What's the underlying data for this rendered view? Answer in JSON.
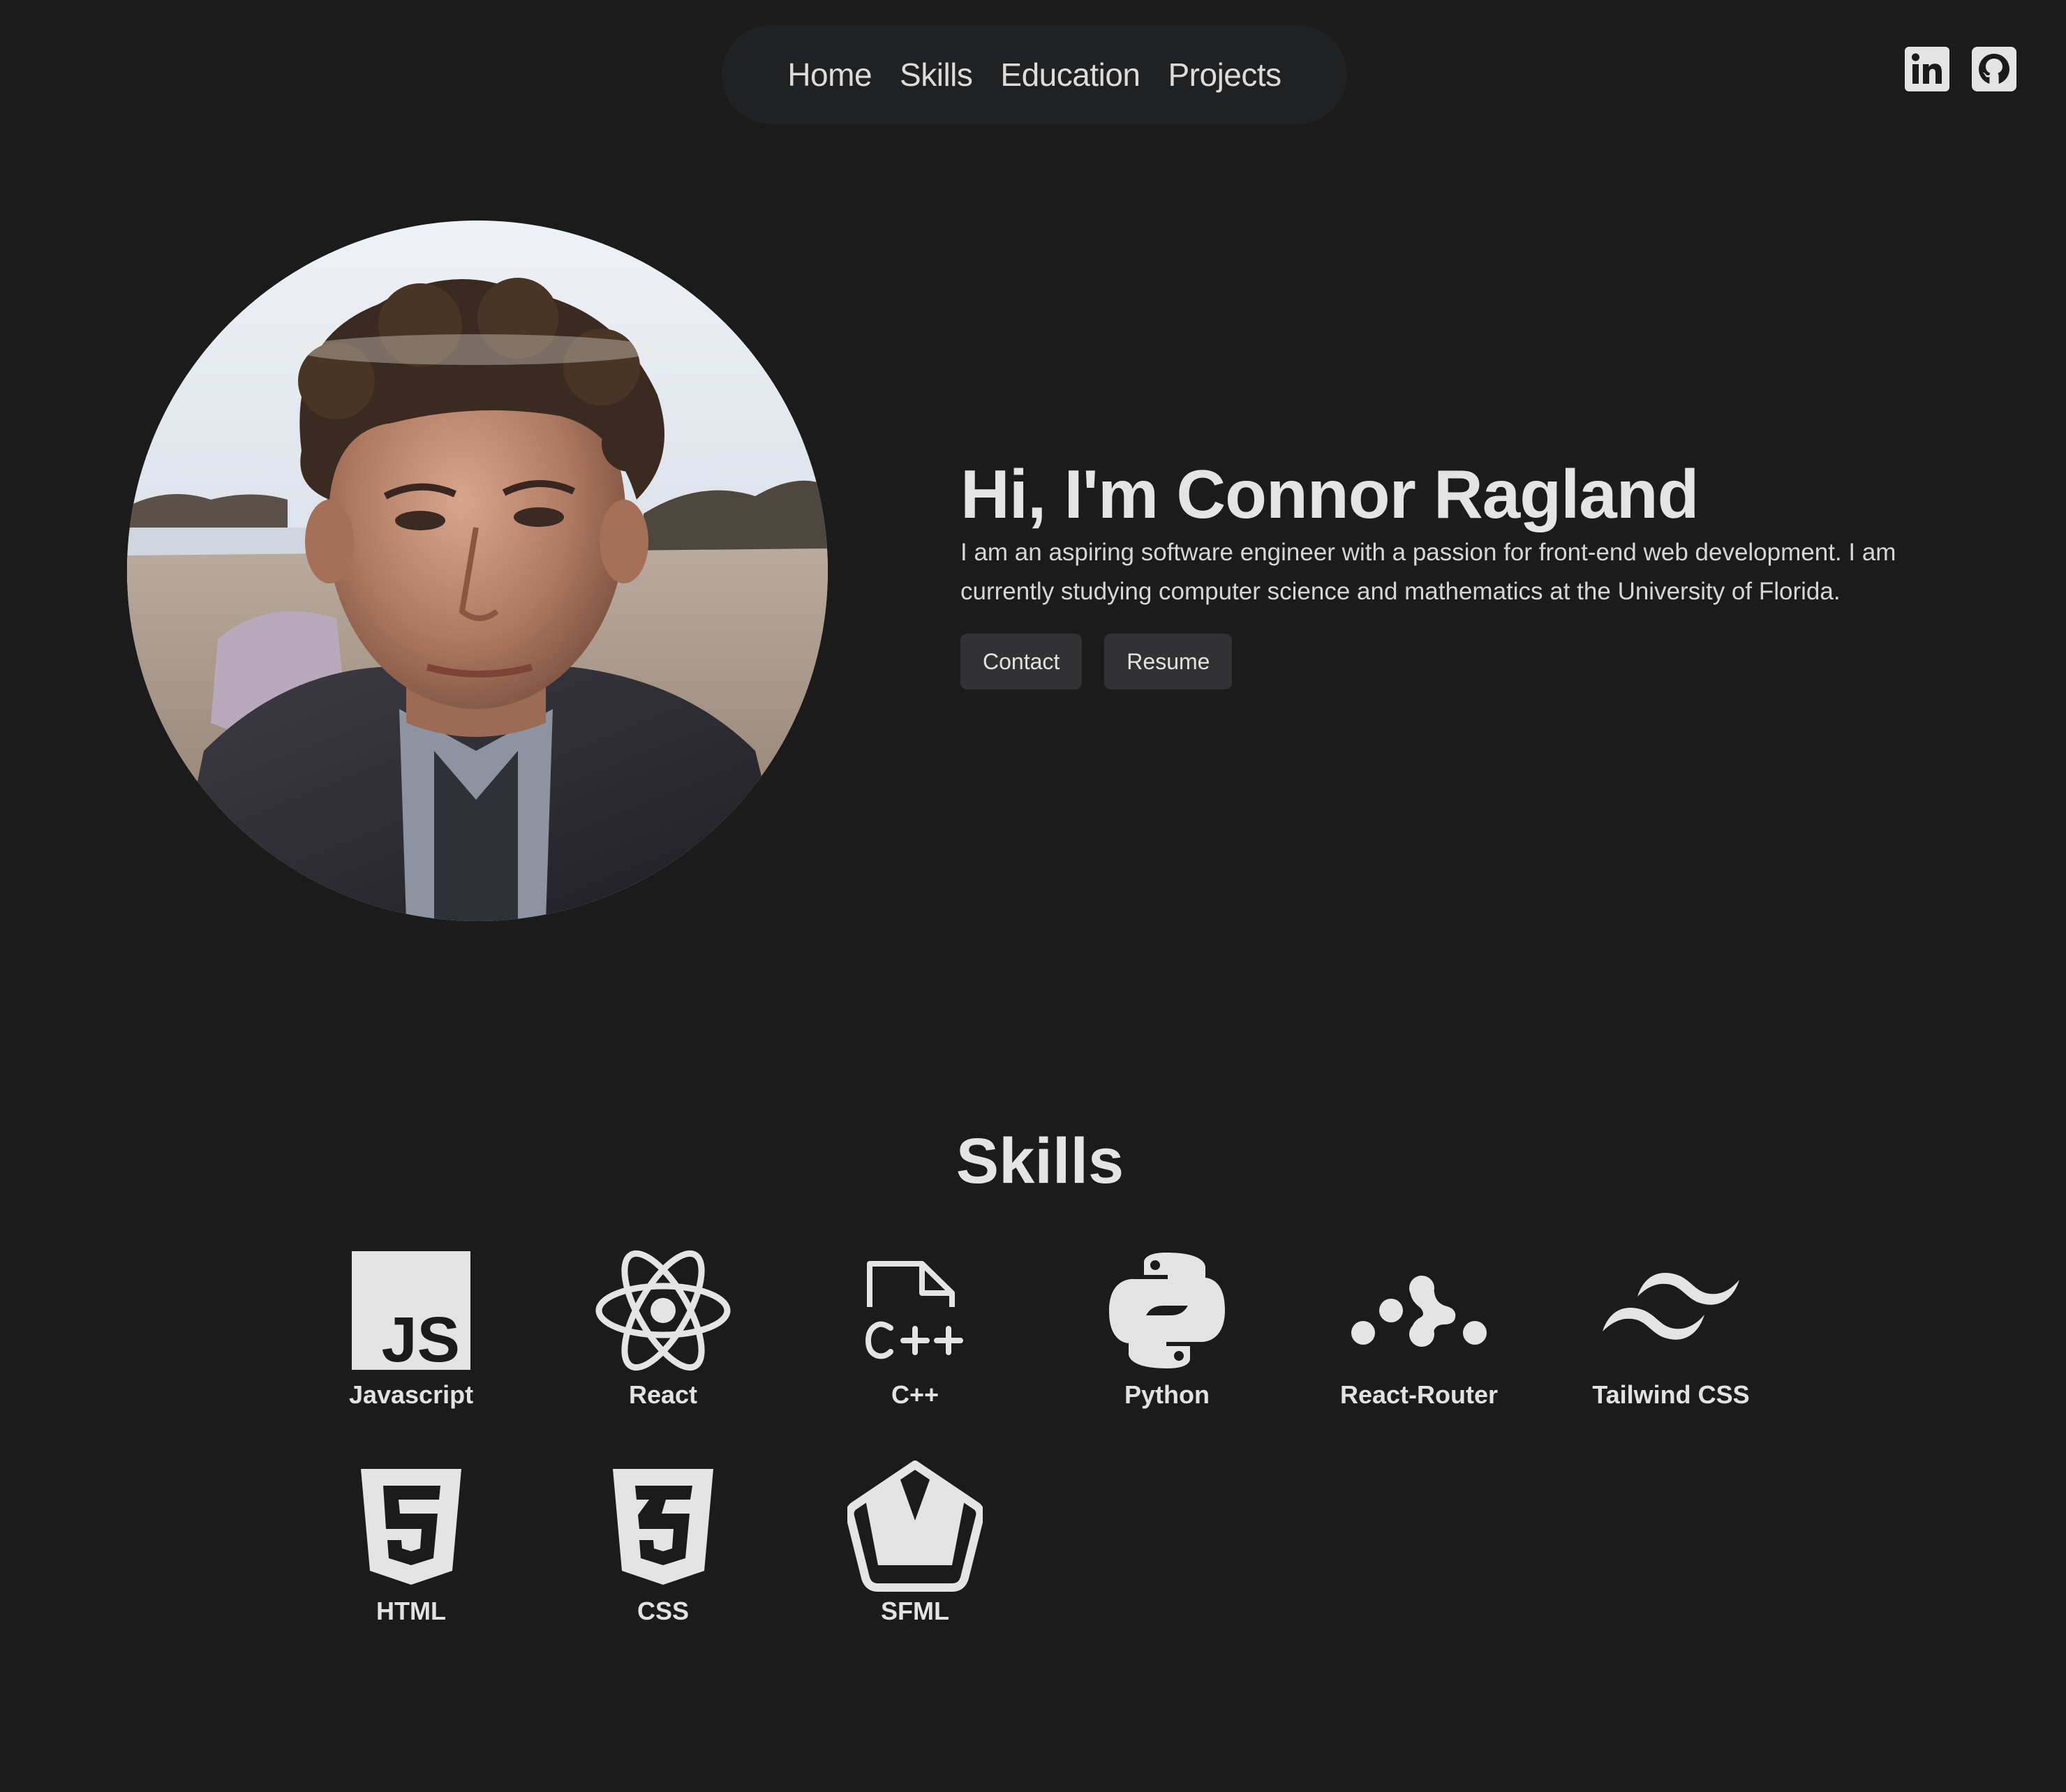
{
  "nav": {
    "items": [
      "Home",
      "Skills",
      "Education",
      "Projects"
    ]
  },
  "socials": {
    "icons": [
      "linkedin-icon",
      "github-icon"
    ]
  },
  "hero": {
    "title": "Hi, I'm Connor Ragland",
    "description": "I am an aspiring software engineer with a passion for front-end web development. I am currently studying computer science and mathematics at the University of Florida.",
    "contact_label": "Contact",
    "resume_label": "Resume"
  },
  "skills": {
    "title": "Skills",
    "items": [
      {
        "label": "Javascript",
        "icon": "javascript-icon"
      },
      {
        "label": "React",
        "icon": "react-icon"
      },
      {
        "label": "C++",
        "icon": "cplusplus-icon"
      },
      {
        "label": "Python",
        "icon": "python-icon"
      },
      {
        "label": "React-Router",
        "icon": "react-router-icon"
      },
      {
        "label": "Tailwind CSS",
        "icon": "tailwind-icon"
      },
      {
        "label": "HTML",
        "icon": "html5-icon"
      },
      {
        "label": "CSS",
        "icon": "css3-icon"
      },
      {
        "label": "SFML",
        "icon": "sfml-icon"
      }
    ]
  },
  "colors": {
    "background": "#1b1b1b",
    "nav_pill": "#202123",
    "button": "#323234",
    "text": "#e6e6e6"
  }
}
